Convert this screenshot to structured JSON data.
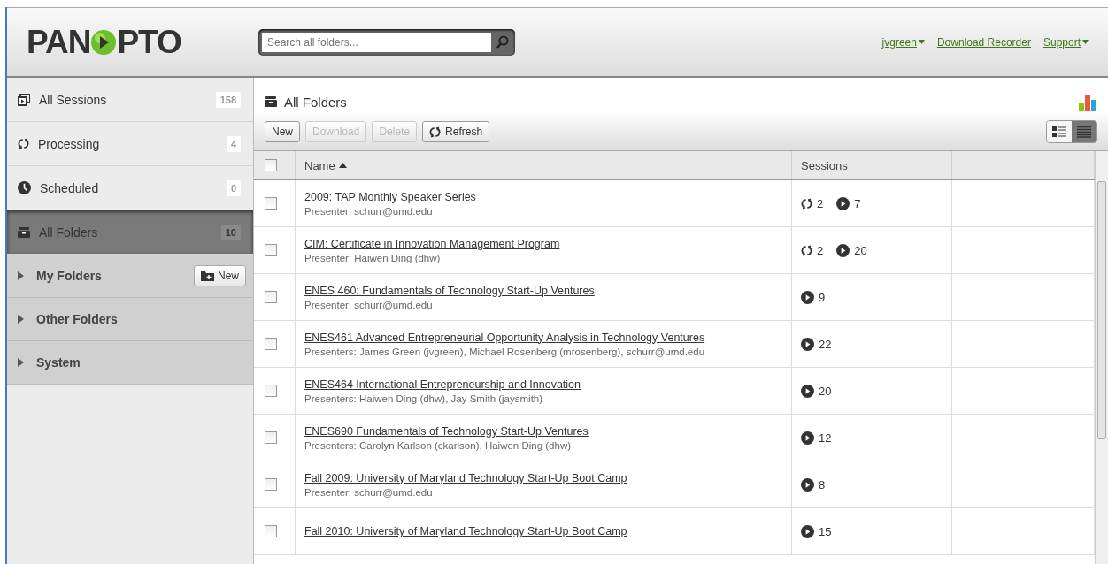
{
  "header": {
    "logo": {
      "left": "PAN",
      "right": "PTO"
    },
    "search": {
      "placeholder": "Search all folders..."
    },
    "links": [
      {
        "label": "jvgreen",
        "dropdown": true
      },
      {
        "label": "Download Recorder",
        "dropdown": false
      },
      {
        "label": "Support",
        "dropdown": true
      }
    ]
  },
  "sidebar": {
    "items": [
      {
        "label": "All Sessions",
        "kind": "sessions",
        "count": "158",
        "selected": false
      },
      {
        "label": "Processing",
        "kind": "processing",
        "count": "4",
        "selected": false
      },
      {
        "label": "Scheduled",
        "kind": "scheduled",
        "count": "0",
        "selected": false
      },
      {
        "label": "All Folders",
        "kind": "folders",
        "count": "10",
        "selected": true
      }
    ],
    "sections": [
      {
        "label": "My Folders",
        "expanded": false,
        "action": "New"
      },
      {
        "label": "Other Folders",
        "expanded": false
      },
      {
        "label": "System",
        "expanded": false
      }
    ]
  },
  "main": {
    "title": "All Folders",
    "toolbar": [
      {
        "label": "New",
        "disabled": false,
        "kind": "plain"
      },
      {
        "label": "Download",
        "disabled": true,
        "kind": "plain"
      },
      {
        "label": "Delete",
        "disabled": true,
        "kind": "plain"
      },
      {
        "label": "Refresh",
        "disabled": false,
        "kind": "refresh"
      }
    ],
    "views": [
      {
        "kind": "details",
        "selected": false
      },
      {
        "kind": "list",
        "selected": true
      }
    ],
    "table": {
      "all_checked": false,
      "columns": [
        {
          "label": "Name",
          "sorted": true
        },
        {
          "label": "Sessions",
          "sorted": false
        }
      ],
      "rows": [
        {
          "title": "2009: TAP Monthly Speaker Series",
          "presenter": "Presenter: schurr@umd.edu",
          "processing": "2",
          "sessions": "7",
          "checked": false
        },
        {
          "title": "CIM: Certificate in Innovation Management Program",
          "presenter": "Presenter: Haiwen Ding (dhw)",
          "processing": "2",
          "sessions": "20",
          "checked": false
        },
        {
          "title": "ENES 460: Fundamentals of Technology Start-Up Ventures",
          "presenter": "Presenter: schurr@umd.edu",
          "sessions": "9",
          "checked": false
        },
        {
          "title": "ENES461 Advanced Entrepreneurial Opportunity Analysis in Technology Ventures",
          "presenter": "Presenters: James Green (jvgreen), Michael Rosenberg (mrosenberg), schurr@umd.edu",
          "sessions": "22",
          "checked": false
        },
        {
          "title": "ENES464 International Entrepreneurship and Innovation",
          "presenter": "Presenters: Haiwen Ding (dhw), Jay Smith (jaysmith)",
          "sessions": "20",
          "checked": false
        },
        {
          "title": "ENES690 Fundamentals of Technology Start-Up Ventures",
          "presenter": "Presenters: Carolyn Karlson (ckarlson), Haiwen Ding (dhw)",
          "sessions": "12",
          "checked": false
        },
        {
          "title": "Fall 2009: University of Maryland Technology Start-Up Boot Camp",
          "presenter": "Presenter: schurr@umd.edu",
          "sessions": "8",
          "checked": false
        },
        {
          "title": "Fall 2010: University of Maryland Technology Start-Up Boot Camp",
          "sessions": "15",
          "checked": false
        }
      ]
    }
  }
}
